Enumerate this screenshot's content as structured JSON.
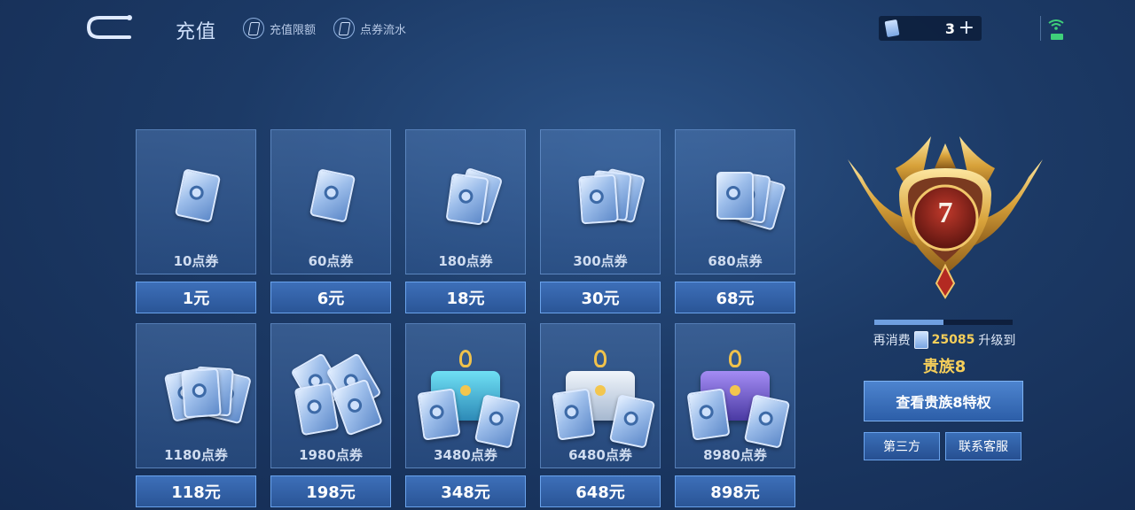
{
  "header": {
    "title": "充值",
    "links": [
      {
        "label": "充值限额"
      },
      {
        "label": "点券流水"
      }
    ],
    "wallet_amount": "3",
    "plus_icon": "plus-icon"
  },
  "packs": [
    {
      "qty": "10点券",
      "price": "1元",
      "art": "ticket-1"
    },
    {
      "qty": "60点券",
      "price": "6元",
      "art": "ticket-1"
    },
    {
      "qty": "180点券",
      "price": "18元",
      "art": "ticket-2"
    },
    {
      "qty": "300点券",
      "price": "30元",
      "art": "ticket-3"
    },
    {
      "qty": "680点券",
      "price": "68元",
      "art": "ticket-4"
    },
    {
      "qty": "1180点券",
      "price": "118元",
      "art": "ticket-5"
    },
    {
      "qty": "1980点券",
      "price": "198元",
      "art": "ticket-stack"
    },
    {
      "qty": "3480点券",
      "price": "348元",
      "art": "chest-teal"
    },
    {
      "qty": "6480点券",
      "price": "648元",
      "art": "chest-silver"
    },
    {
      "qty": "8980点券",
      "price": "898元",
      "art": "chest-purple"
    }
  ],
  "vip": {
    "level": "7",
    "progress": 0.5,
    "spend_prefix": "再消费",
    "spend_amount": "25085",
    "spend_suffix": "升级到",
    "next_level": "贵族8",
    "privilege_button": "查看贵族8特权",
    "third_party_button": "第三方",
    "support_button": "联系客服"
  },
  "colors": {
    "accent": "#6aa3ec",
    "gold": "#f6cf5a",
    "background": "#1c3a66"
  }
}
